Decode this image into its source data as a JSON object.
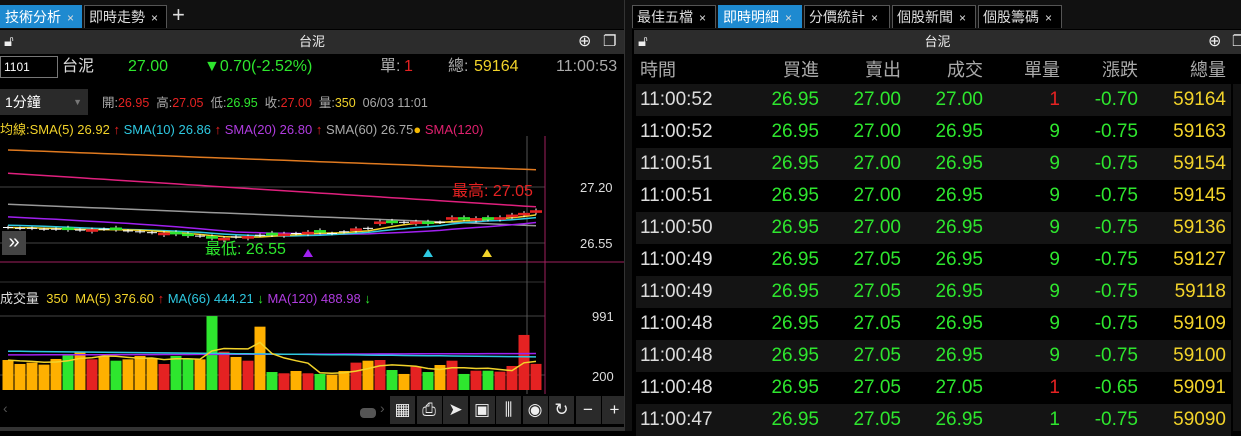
{
  "left_tabs": [
    {
      "label": "技術分析",
      "active": true
    },
    {
      "label": "即時走勢",
      "active": false
    }
  ],
  "add_tab": "+",
  "close_glyph": "×",
  "left_panel": {
    "title": "台泥",
    "code": "1101",
    "name": "台泥",
    "price": "27.00",
    "change": "▼0.70(-2.52%)",
    "single_label": "單:",
    "single": "1",
    "total_label": "總:",
    "total": "59164",
    "time": "11:00:53",
    "interval": "1分鐘",
    "ohlc": {
      "open_l": "開:",
      "open": "26.95",
      "high_l": "高:",
      "high": "27.05",
      "low_l": "低:",
      "low": "26.95",
      "close_l": "收:",
      "close": "27.00",
      "vol_l": "量:",
      "vol": "350",
      "datetime": "06/03 11:01"
    },
    "ma_legend": {
      "prefix": "均線:",
      "sma5": "SMA(5) 26.92",
      "sma10": "SMA(10) 26.86",
      "sma20": "SMA(20) 26.80",
      "sma60": "SMA(60) 26.75",
      "sma120": "SMA(120)",
      "up": "↑"
    },
    "vol_legend": {
      "label": "成交量",
      "vol": "350",
      "ma5": "MA(5) 376.60",
      "ma66": "MA(66) 444.21",
      "ma120": "MA(120) 488.98",
      "up": "↑",
      "down": "↓"
    },
    "toolbar": [
      "▦",
      "⎙",
      "➤",
      "▣",
      "⫼",
      "◉",
      "↻",
      "−",
      "+"
    ]
  },
  "chart_data": {
    "type": "candlestick",
    "price_ticks": [
      "27.20",
      "26.55"
    ],
    "price_tick_values": [
      27.2,
      26.55
    ],
    "max_label": "最高: 27.05",
    "min_label": "最低: 26.55",
    "open": [
      26.73,
      26.72,
      26.72,
      26.71,
      26.71,
      26.73,
      26.7,
      26.68,
      26.71,
      26.73,
      26.69,
      26.68,
      26.67,
      26.64,
      26.68,
      26.66,
      26.63,
      26.63,
      26.58,
      26.62,
      26.6,
      26.64,
      26.67,
      26.63,
      26.66,
      26.65,
      26.7,
      26.66,
      26.68,
      26.69,
      26.72,
      26.77,
      26.81,
      26.79,
      26.77,
      26.8,
      26.79,
      26.82,
      26.85,
      26.81,
      26.85,
      26.82,
      26.85,
      26.87,
      26.9
    ],
    "close": [
      26.73,
      26.72,
      26.72,
      26.71,
      26.71,
      26.7,
      26.7,
      26.71,
      26.71,
      26.7,
      26.69,
      26.68,
      26.67,
      26.67,
      26.65,
      26.63,
      26.63,
      26.6,
      26.61,
      26.62,
      26.63,
      26.64,
      26.64,
      26.66,
      26.66,
      26.68,
      26.67,
      26.66,
      26.68,
      26.72,
      26.72,
      26.8,
      26.78,
      26.79,
      26.8,
      26.77,
      26.79,
      26.85,
      26.82,
      26.84,
      26.82,
      26.85,
      26.88,
      26.9,
      26.93
    ],
    "sma60": [
      27.0,
      26.75
    ],
    "sma120": [
      27.36,
      26.97
    ],
    "sma240": [
      27.63,
      27.4
    ],
    "volume_ticks": [
      "991",
      "200"
    ],
    "volume_tick_values": [
      991,
      200
    ],
    "volume": [
      402,
      349,
      367,
      340,
      416,
      483,
      514,
      411,
      456,
      393,
      411,
      456,
      429,
      349,
      456,
      411,
      411,
      991,
      514,
      443,
      393,
      849,
      241,
      224,
      255,
      224,
      215,
      206,
      255,
      367,
      393,
      402,
      268,
      215,
      313,
      241,
      335,
      393,
      215,
      259,
      259,
      246,
      322,
      738,
      350
    ],
    "vol_ma66": [
      520,
      444
    ],
    "vol_ma120": [
      470,
      489
    ]
  },
  "right_tabs": [
    {
      "label": "最佳五檔",
      "active": false
    },
    {
      "label": "即時明細",
      "active": true
    },
    {
      "label": "分價統計",
      "active": false
    },
    {
      "label": "個股新聞",
      "active": false
    },
    {
      "label": "個股籌碼",
      "active": false
    }
  ],
  "right_panel": {
    "title": "台泥",
    "headers": [
      "時間",
      "買進",
      "賣出",
      "成交",
      "單量",
      "漲跌",
      "總量"
    ],
    "rows": [
      [
        "11:00:52",
        "26.95",
        "27.00",
        "27.00",
        "1",
        "-0.70",
        "59164"
      ],
      [
        "11:00:52",
        "26.95",
        "27.00",
        "26.95",
        "9",
        "-0.75",
        "59163"
      ],
      [
        "11:00:51",
        "26.95",
        "27.00",
        "26.95",
        "9",
        "-0.75",
        "59154"
      ],
      [
        "11:00:51",
        "26.95",
        "27.00",
        "26.95",
        "9",
        "-0.75",
        "59145"
      ],
      [
        "11:00:50",
        "26.95",
        "27.00",
        "26.95",
        "9",
        "-0.75",
        "59136"
      ],
      [
        "11:00:49",
        "26.95",
        "27.05",
        "26.95",
        "9",
        "-0.75",
        "59127"
      ],
      [
        "11:00:49",
        "26.95",
        "27.05",
        "26.95",
        "9",
        "-0.75",
        "59118"
      ],
      [
        "11:00:48",
        "26.95",
        "27.05",
        "26.95",
        "9",
        "-0.75",
        "59109"
      ],
      [
        "11:00:48",
        "26.95",
        "27.05",
        "26.95",
        "9",
        "-0.75",
        "59100"
      ],
      [
        "11:00:48",
        "26.95",
        "27.05",
        "27.05",
        "1",
        "-0.65",
        "59091"
      ],
      [
        "11:00:47",
        "26.95",
        "27.05",
        "26.95",
        "1",
        "-0.75",
        "59090"
      ]
    ],
    "qty_colors": [
      "red",
      "green",
      "green",
      "green",
      "green",
      "green",
      "green",
      "green",
      "green",
      "red",
      "green"
    ]
  },
  "colors": {
    "up": "#e52222",
    "down": "#2ee62e",
    "flat": "#ffb000",
    "accent": "#1e8ad0",
    "volume": "#f2d32a"
  }
}
